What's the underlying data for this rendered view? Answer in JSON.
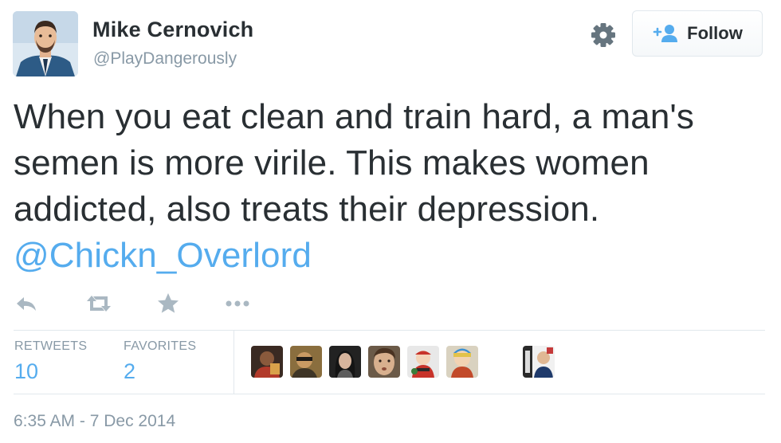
{
  "author": {
    "name": "Mike Cernovich",
    "handle": "@PlayDangerously",
    "avatar_icon": "user-avatar"
  },
  "header": {
    "settings_icon": "gear-icon",
    "follow_button": {
      "label": "Follow",
      "icon": "add-user-icon"
    }
  },
  "tweet": {
    "lines": [
      "When you eat clean and train hard, a man's",
      "semen is more virile. This makes women",
      "addicted, also treats their depression."
    ],
    "mention": "@Chickn_Overlord"
  },
  "actions": [
    {
      "icon": "reply-icon"
    },
    {
      "icon": "retweet-icon"
    },
    {
      "icon": "favorite-star-icon"
    },
    {
      "icon": "more-dots-icon"
    }
  ],
  "stats": {
    "retweets_label": "RETWEETS",
    "retweets_count": "10",
    "favorites_label": "FAVORITES",
    "favorites_count": "2"
  },
  "favoriters": [
    {
      "icon": "user-avatar"
    },
    {
      "icon": "user-avatar"
    },
    {
      "icon": "user-avatar"
    },
    {
      "icon": "user-avatar"
    },
    {
      "icon": "user-avatar"
    },
    {
      "icon": "user-avatar"
    },
    {
      "icon": "user-avatar"
    }
  ],
  "timestamp": "6:35 AM - 7 Dec 2014",
  "colors": {
    "link": "#55acee",
    "text": "#292f33",
    "muted": "#8899a6",
    "border": "#e1e8ed"
  }
}
